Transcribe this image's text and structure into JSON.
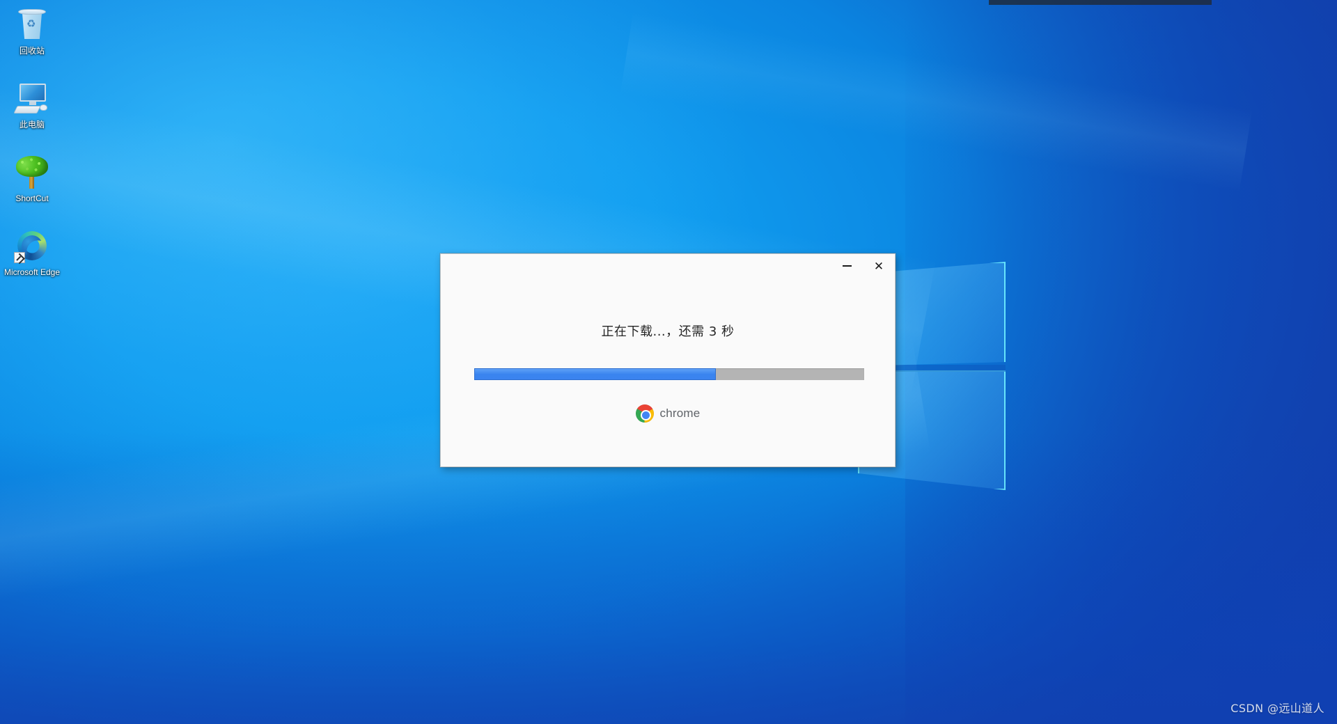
{
  "desktop": {
    "wallpaper_name": "windows-10-hero-blue",
    "colors": {
      "wallpaper_primary": "#0b84e0",
      "wallpaper_dark": "#1249ab",
      "wallpaper_light": "#1aa6f5",
      "logo_edge": "#6ef0ff"
    },
    "icons": [
      {
        "label": "回收站",
        "icon": "recycle-bin-icon",
        "name": "desktop-icon-recycle-bin"
      },
      {
        "label": "此电脑",
        "icon": "this-pc-icon",
        "name": "desktop-icon-this-pc"
      },
      {
        "label": "ShortCut",
        "icon": "tree-icon",
        "name": "desktop-icon-shortcut"
      },
      {
        "label": "Microsoft Edge",
        "icon": "microsoft-edge-icon",
        "name": "desktop-icon-microsoft-edge"
      }
    ]
  },
  "dialog": {
    "name": "chrome-installer-dialog",
    "status_text": "正在下载...，还需 3 秒",
    "minimize_label": "–",
    "close_label": "✕",
    "minimize_icon": "minimize-icon",
    "close_icon": "close-icon",
    "progress": {
      "percent": 62,
      "fill_color": "#3a84ef",
      "track_color": "#b4b4b4"
    },
    "brand": {
      "logo_icon": "chrome-logo-icon",
      "wordmark": "chrome",
      "wordmark_color": "#5f6368"
    },
    "background_color": "#fafafa",
    "border_color": "#c8c8c8"
  },
  "watermark": {
    "text": "CSDN @远山道人"
  }
}
